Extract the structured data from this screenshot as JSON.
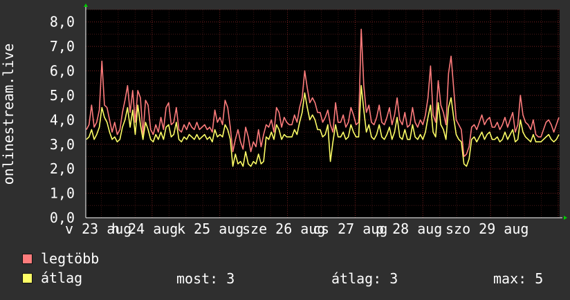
{
  "chart_data": {
    "type": "line",
    "ylabel": "onlinestream.live",
    "y_ticks": [
      "0,0",
      "1,0",
      "2,0",
      "3,0",
      "4,0",
      "5,0",
      "6,0",
      "7,0",
      "8,0"
    ],
    "ylim": [
      0,
      8.5
    ],
    "x_labels": [
      "v 23 aug",
      "h 24 aug",
      "k 25 aug",
      "sze 26 aug",
      "cs 27 aug",
      "p 28 aug",
      "szo 29 aug"
    ],
    "grid": true,
    "series": [
      {
        "name": "legtöbb",
        "color": "#ff7c7c",
        "values": [
          3.6,
          3.8,
          4.6,
          3.7,
          3.9,
          4.4,
          6.4,
          4.6,
          4.5,
          4.0,
          3.5,
          3.9,
          3.4,
          3.6,
          4.3,
          4.8,
          5.4,
          4.3,
          5.2,
          3.9,
          5.2,
          4.9,
          3.4,
          4.8,
          4.6,
          3.6,
          3.4,
          3.8,
          3.5,
          4.1,
          3.6,
          4.5,
          4.7,
          3.8,
          3.9,
          4.5,
          3.6,
          3.5,
          3.8,
          3.6,
          3.9,
          3.7,
          3.6,
          3.9,
          3.6,
          3.7,
          3.8,
          3.6,
          3.7,
          3.5,
          4.4,
          3.9,
          4.1,
          3.8,
          4.8,
          4.5,
          3.7,
          2.7,
          3.2,
          3.6,
          3.1,
          2.8,
          3.7,
          3.3,
          2.7,
          3.1,
          2.9,
          3.6,
          2.9,
          3.4,
          3.8,
          3.7,
          4.0,
          3.5,
          4.5,
          4.3,
          3.7,
          4.1,
          3.9,
          3.8,
          3.8,
          4.2,
          3.9,
          4.5,
          4.9,
          6.0,
          5.3,
          4.7,
          4.9,
          4.7,
          4.3,
          4.3,
          3.9,
          4.1,
          4.4,
          3.8,
          3.5,
          4.7,
          3.9,
          3.9,
          4.2,
          3.7,
          3.9,
          4.5,
          4.2,
          3.8,
          3.9,
          7.7,
          5.4,
          4.3,
          4.6,
          3.9,
          3.8,
          4.1,
          4.6,
          3.9,
          3.8,
          4.1,
          4.5,
          3.8,
          4.2,
          4.9,
          4.0,
          3.8,
          4.3,
          3.7,
          3.8,
          4.5,
          3.9,
          3.7,
          4.0,
          3.8,
          4.2,
          4.9,
          6.2,
          4.2,
          3.9,
          5.6,
          4.6,
          4.3,
          3.8,
          5.9,
          6.6,
          5.3,
          4.0,
          3.8,
          3.6,
          2.5,
          2.6,
          2.9,
          3.7,
          3.8,
          3.6,
          3.9,
          4.2,
          3.8,
          4.0,
          4.1,
          3.7,
          3.7,
          3.9,
          3.6,
          3.8,
          4.1,
          3.7,
          4.0,
          4.3,
          3.5,
          3.8,
          5.0,
          4.2,
          3.9,
          3.8,
          3.6,
          4.0,
          3.4,
          3.3,
          3.3,
          3.6,
          3.9,
          4.0,
          3.8,
          3.5,
          3.8,
          4.1
        ]
      },
      {
        "name": "átlag",
        "color": "#ffff66",
        "values": [
          3.2,
          3.3,
          3.6,
          3.2,
          3.4,
          3.7,
          4.5,
          4.1,
          3.9,
          3.5,
          3.2,
          3.3,
          3.1,
          3.2,
          3.7,
          4.0,
          4.5,
          3.7,
          4.4,
          3.4,
          4.6,
          3.8,
          3.2,
          3.9,
          3.6,
          3.2,
          3.1,
          3.4,
          3.2,
          3.5,
          3.2,
          3.7,
          3.8,
          3.3,
          3.4,
          3.9,
          3.2,
          3.1,
          3.3,
          3.2,
          3.4,
          3.3,
          3.2,
          3.4,
          3.2,
          3.3,
          3.4,
          3.2,
          3.3,
          3.1,
          3.6,
          3.3,
          3.4,
          3.3,
          3.8,
          3.6,
          3.2,
          2.1,
          2.6,
          2.2,
          2.3,
          2.1,
          2.7,
          2.2,
          2.1,
          2.3,
          2.2,
          2.6,
          2.2,
          2.3,
          3.3,
          3.2,
          3.5,
          3.2,
          3.8,
          3.6,
          3.2,
          3.4,
          3.3,
          3.3,
          3.3,
          3.6,
          3.4,
          3.9,
          4.3,
          5.1,
          4.5,
          4.0,
          4.2,
          4.0,
          3.6,
          3.6,
          3.3,
          3.4,
          3.8,
          2.3,
          3.1,
          3.8,
          3.3,
          3.3,
          3.5,
          3.2,
          3.3,
          3.8,
          3.5,
          3.3,
          3.3,
          5.4,
          4.4,
          3.5,
          3.8,
          3.3,
          3.2,
          3.4,
          3.8,
          3.3,
          3.2,
          3.4,
          3.7,
          3.2,
          3.5,
          4.1,
          3.3,
          3.2,
          3.6,
          3.2,
          3.2,
          3.8,
          3.3,
          3.2,
          3.4,
          3.2,
          3.5,
          4.1,
          4.6,
          3.5,
          3.3,
          4.7,
          3.8,
          3.6,
          3.2,
          4.5,
          4.9,
          4.1,
          3.4,
          3.2,
          3.1,
          2.2,
          2.1,
          2.4,
          3.2,
          3.3,
          3.1,
          3.3,
          3.5,
          3.2,
          3.4,
          3.5,
          3.2,
          3.2,
          3.3,
          3.1,
          3.2,
          3.5,
          3.2,
          3.4,
          3.6,
          3.1,
          3.2,
          4.0,
          3.5,
          3.3,
          3.2,
          3.1,
          3.4,
          3.1,
          3.1,
          3.1,
          3.2,
          3.3,
          3.4,
          3.2,
          3.1,
          3.2,
          3.4
        ]
      }
    ]
  },
  "legend": [
    {
      "label": "legtöbb",
      "color": "#ff7c7c"
    },
    {
      "label": "átlag",
      "color": "#ffff66"
    }
  ],
  "stats": {
    "most": "most: 3",
    "atlag": "átlag: 3",
    "max": "max: 5"
  }
}
